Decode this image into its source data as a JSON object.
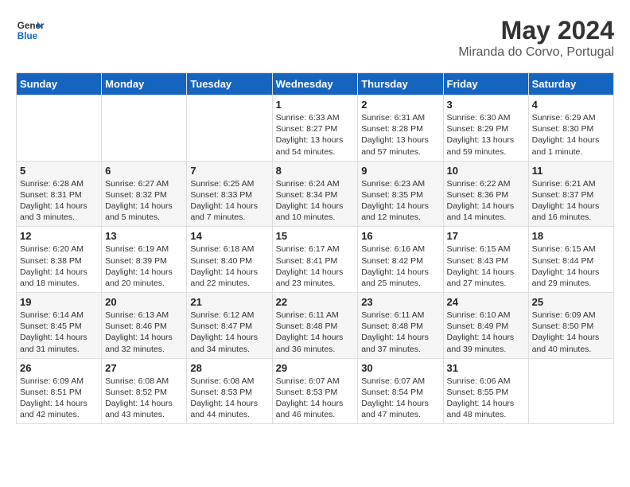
{
  "header": {
    "logo_line1": "General",
    "logo_line2": "Blue",
    "month": "May 2024",
    "location": "Miranda do Corvo, Portugal"
  },
  "weekdays": [
    "Sunday",
    "Monday",
    "Tuesday",
    "Wednesday",
    "Thursday",
    "Friday",
    "Saturday"
  ],
  "weeks": [
    [
      {
        "day": "",
        "info": ""
      },
      {
        "day": "",
        "info": ""
      },
      {
        "day": "",
        "info": ""
      },
      {
        "day": "1",
        "info": "Sunrise: 6:33 AM\nSunset: 8:27 PM\nDaylight: 13 hours\nand 54 minutes."
      },
      {
        "day": "2",
        "info": "Sunrise: 6:31 AM\nSunset: 8:28 PM\nDaylight: 13 hours\nand 57 minutes."
      },
      {
        "day": "3",
        "info": "Sunrise: 6:30 AM\nSunset: 8:29 PM\nDaylight: 13 hours\nand 59 minutes."
      },
      {
        "day": "4",
        "info": "Sunrise: 6:29 AM\nSunset: 8:30 PM\nDaylight: 14 hours\nand 1 minute."
      }
    ],
    [
      {
        "day": "5",
        "info": "Sunrise: 6:28 AM\nSunset: 8:31 PM\nDaylight: 14 hours\nand 3 minutes."
      },
      {
        "day": "6",
        "info": "Sunrise: 6:27 AM\nSunset: 8:32 PM\nDaylight: 14 hours\nand 5 minutes."
      },
      {
        "day": "7",
        "info": "Sunrise: 6:25 AM\nSunset: 8:33 PM\nDaylight: 14 hours\nand 7 minutes."
      },
      {
        "day": "8",
        "info": "Sunrise: 6:24 AM\nSunset: 8:34 PM\nDaylight: 14 hours\nand 10 minutes."
      },
      {
        "day": "9",
        "info": "Sunrise: 6:23 AM\nSunset: 8:35 PM\nDaylight: 14 hours\nand 12 minutes."
      },
      {
        "day": "10",
        "info": "Sunrise: 6:22 AM\nSunset: 8:36 PM\nDaylight: 14 hours\nand 14 minutes."
      },
      {
        "day": "11",
        "info": "Sunrise: 6:21 AM\nSunset: 8:37 PM\nDaylight: 14 hours\nand 16 minutes."
      }
    ],
    [
      {
        "day": "12",
        "info": "Sunrise: 6:20 AM\nSunset: 8:38 PM\nDaylight: 14 hours\nand 18 minutes."
      },
      {
        "day": "13",
        "info": "Sunrise: 6:19 AM\nSunset: 8:39 PM\nDaylight: 14 hours\nand 20 minutes."
      },
      {
        "day": "14",
        "info": "Sunrise: 6:18 AM\nSunset: 8:40 PM\nDaylight: 14 hours\nand 22 minutes."
      },
      {
        "day": "15",
        "info": "Sunrise: 6:17 AM\nSunset: 8:41 PM\nDaylight: 14 hours\nand 23 minutes."
      },
      {
        "day": "16",
        "info": "Sunrise: 6:16 AM\nSunset: 8:42 PM\nDaylight: 14 hours\nand 25 minutes."
      },
      {
        "day": "17",
        "info": "Sunrise: 6:15 AM\nSunset: 8:43 PM\nDaylight: 14 hours\nand 27 minutes."
      },
      {
        "day": "18",
        "info": "Sunrise: 6:15 AM\nSunset: 8:44 PM\nDaylight: 14 hours\nand 29 minutes."
      }
    ],
    [
      {
        "day": "19",
        "info": "Sunrise: 6:14 AM\nSunset: 8:45 PM\nDaylight: 14 hours\nand 31 minutes."
      },
      {
        "day": "20",
        "info": "Sunrise: 6:13 AM\nSunset: 8:46 PM\nDaylight: 14 hours\nand 32 minutes."
      },
      {
        "day": "21",
        "info": "Sunrise: 6:12 AM\nSunset: 8:47 PM\nDaylight: 14 hours\nand 34 minutes."
      },
      {
        "day": "22",
        "info": "Sunrise: 6:11 AM\nSunset: 8:48 PM\nDaylight: 14 hours\nand 36 minutes."
      },
      {
        "day": "23",
        "info": "Sunrise: 6:11 AM\nSunset: 8:48 PM\nDaylight: 14 hours\nand 37 minutes."
      },
      {
        "day": "24",
        "info": "Sunrise: 6:10 AM\nSunset: 8:49 PM\nDaylight: 14 hours\nand 39 minutes."
      },
      {
        "day": "25",
        "info": "Sunrise: 6:09 AM\nSunset: 8:50 PM\nDaylight: 14 hours\nand 40 minutes."
      }
    ],
    [
      {
        "day": "26",
        "info": "Sunrise: 6:09 AM\nSunset: 8:51 PM\nDaylight: 14 hours\nand 42 minutes."
      },
      {
        "day": "27",
        "info": "Sunrise: 6:08 AM\nSunset: 8:52 PM\nDaylight: 14 hours\nand 43 minutes."
      },
      {
        "day": "28",
        "info": "Sunrise: 6:08 AM\nSunset: 8:53 PM\nDaylight: 14 hours\nand 44 minutes."
      },
      {
        "day": "29",
        "info": "Sunrise: 6:07 AM\nSunset: 8:53 PM\nDaylight: 14 hours\nand 46 minutes."
      },
      {
        "day": "30",
        "info": "Sunrise: 6:07 AM\nSunset: 8:54 PM\nDaylight: 14 hours\nand 47 minutes."
      },
      {
        "day": "31",
        "info": "Sunrise: 6:06 AM\nSunset: 8:55 PM\nDaylight: 14 hours\nand 48 minutes."
      },
      {
        "day": "",
        "info": ""
      }
    ]
  ]
}
